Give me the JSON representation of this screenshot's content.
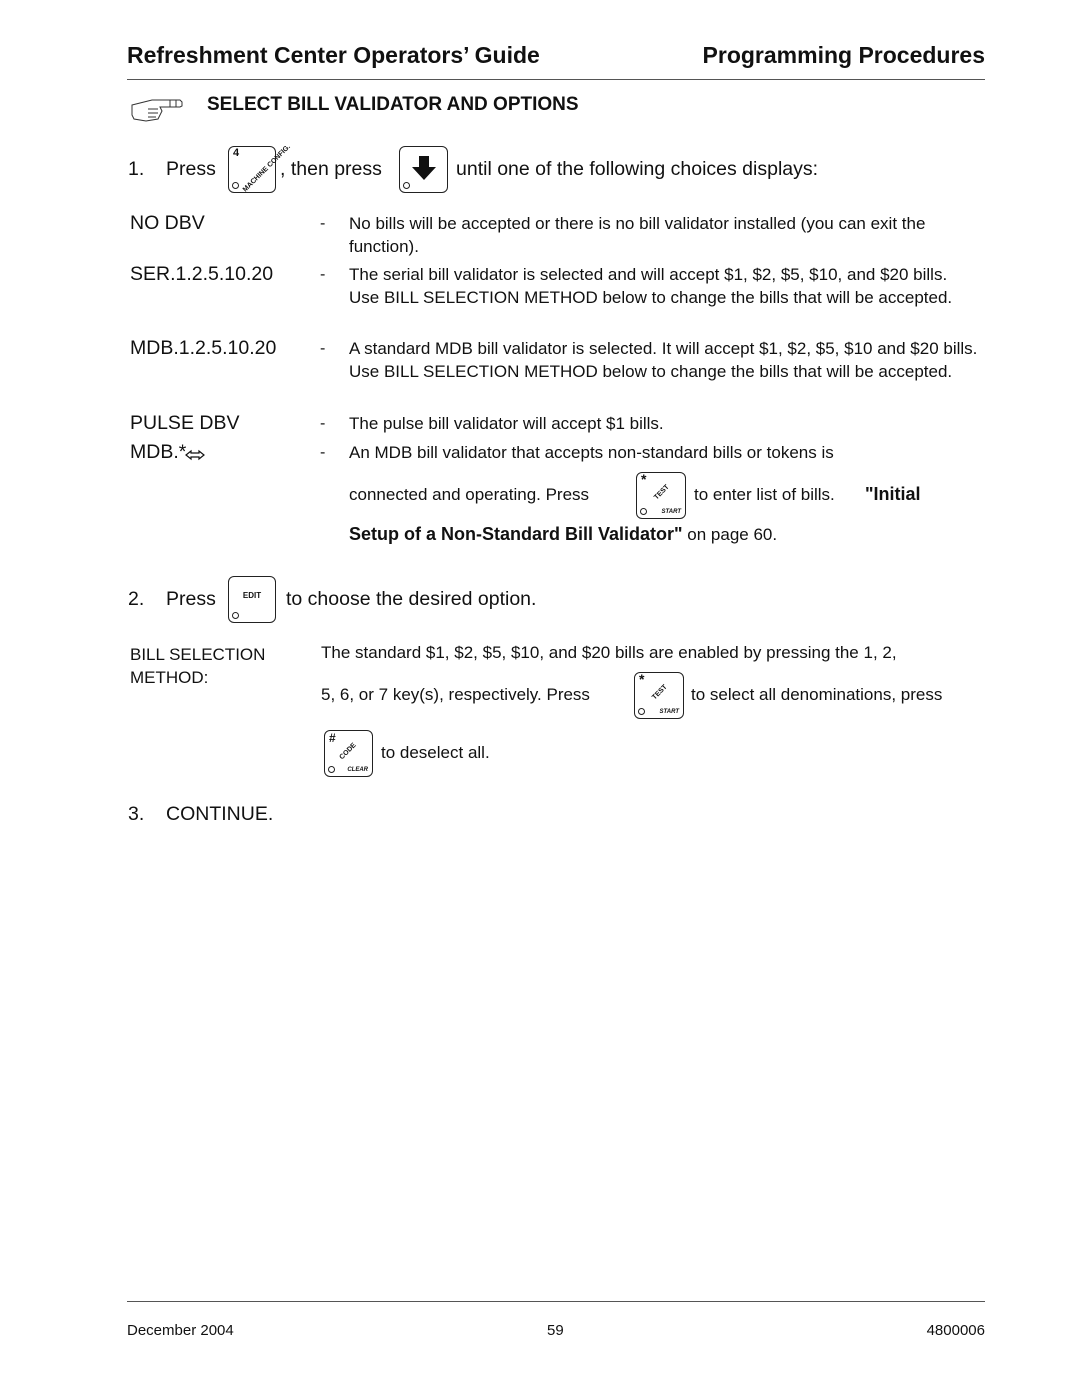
{
  "header": {
    "left_title": "Refreshment Center Operators’ Guide",
    "right_title": "Programming Procedures"
  },
  "section": {
    "icon": "pointing-hand-icon",
    "title": "SELECT BILL VALIDATOR AND OPTIONS"
  },
  "step1": {
    "number": "1.",
    "press": "Press",
    "key1": {
      "icon": "machine-config-key-icon",
      "top": "4",
      "diag": "MACHINE CONFIG."
    },
    "then_press": ", then press",
    "key2": {
      "icon": "down-arrow-key-icon"
    },
    "suffix": "until one of the following choices displays:"
  },
  "options": [
    {
      "name": "NO DBV",
      "dash": "-",
      "desc": "No bills will be accepted or there is no bill validator installed (you can exit the function)."
    },
    {
      "name": "SER.1.2.5.10.20",
      "dash": "-",
      "desc": "The serial bill validator is selected and will accept $1, $2, $5, $10, and $20 bills.  Use BILL SELECTION METHOD below to change the bills that will be accepted."
    },
    {
      "name": "MDB.1.2.5.10.20",
      "dash": "-",
      "desc": "A standard MDB bill validator is selected.  It will accept $1, $2, $5, $10 and $20 bills.  Use BILL SELECTION METHOD below to change the bills that will be accepted."
    },
    {
      "name": "PULSE DBV",
      "dash": "-",
      "desc": "The pulse bill validator will accept $1 bills."
    },
    {
      "name": "MDB.*",
      "dash": "-",
      "desc": "An MDB bill validator that accepts non-standard bills or tokens is"
    }
  ],
  "mdb_star": {
    "line2_prefix": "connected and operating.  Press",
    "key": {
      "icon": "test-start-key-icon",
      "top": "*",
      "diag": "TEST",
      "bottom": "START"
    },
    "line2_suffix": "to enter list of bills.",
    "ref_bold_1": "\"Initial",
    "ref_bold_2": "Setup of a Non-Standard Bill Validator\"",
    "ref_tail": " on page 60."
  },
  "step2": {
    "number": "2.",
    "press": "Press",
    "key": {
      "icon": "edit-key-icon",
      "label": "EDIT"
    },
    "suffix": "to choose the desired option."
  },
  "bill_selection": {
    "label_line1": "BILL SELECTION",
    "label_line2": "METHOD:",
    "line1": "The standard $1, $2, $5, $10, and $20 bills are enabled by pressing the 1, 2,",
    "line2_prefix": "5, 6, or 7 key(s), respectively. Press",
    "key_test": {
      "icon": "test-start-key-icon",
      "top": "*",
      "diag": "TEST",
      "bottom": "START"
    },
    "line2_suffix": "to select all denominations, press",
    "key_code": {
      "icon": "code-clear-key-icon",
      "top": "#",
      "diag": "CODE",
      "bottom": "CLEAR"
    },
    "line3_suffix": "to deselect all."
  },
  "step3": {
    "number": "3.",
    "text": "CONTINUE."
  },
  "footer": {
    "date": "December 2004",
    "page": "59",
    "doc_number": "4800006"
  }
}
